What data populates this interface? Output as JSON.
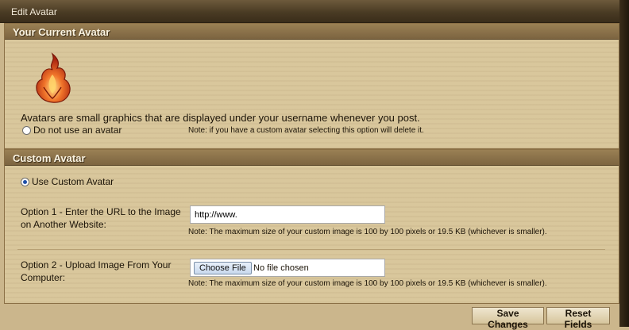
{
  "window": {
    "title": "Edit Avatar"
  },
  "current_avatar": {
    "header": "Your Current Avatar",
    "description": "Avatars are small graphics that are displayed under your username whenever you post.",
    "no_avatar_label": "Do not use an avatar",
    "no_avatar_note": "Note: if you have a custom avatar selecting this option will delete it.",
    "image_icon": "flame-avatar"
  },
  "custom_avatar": {
    "header": "Custom Avatar",
    "use_custom_label": "Use Custom Avatar",
    "option1": {
      "label": "Option 1 - Enter the URL to the Image on Another Website:",
      "value": "http://www.",
      "note": "Note: The maximum size of your custom image is 100 by 100 pixels or 19.5 KB (whichever is smaller)."
    },
    "option2": {
      "label": "Option 2 - Upload Image From Your Computer:",
      "button": "Choose File",
      "status": "No file chosen",
      "note": "Note: The maximum size of your custom image is 100 by 100 pixels or 19.5 KB (whichever is smaller)."
    }
  },
  "actions": {
    "save": "Save Changes",
    "reset": "Reset Fields"
  }
}
